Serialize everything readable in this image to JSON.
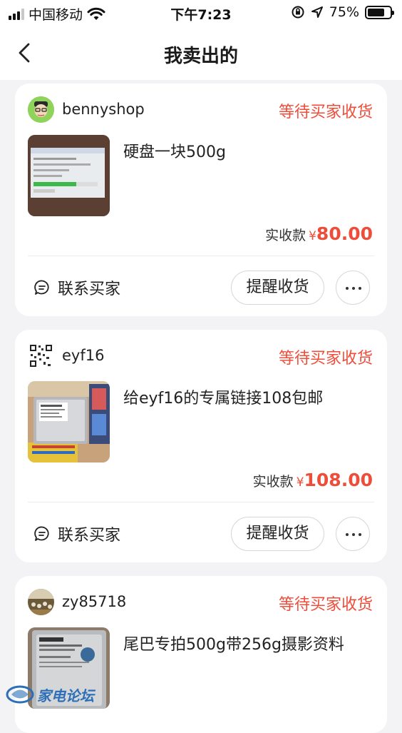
{
  "status_bar": {
    "carrier": "中国移动",
    "time": "下午7:23",
    "battery": "75%",
    "battery_level": 0.75
  },
  "nav": {
    "title": "我卖出的"
  },
  "orders": [
    {
      "username": "bennyshop",
      "status": "等待买家收货",
      "product_title": "硬盘一块500g",
      "price_label": "实收款",
      "currency": "¥",
      "amount": "80.00",
      "contact_label": "联系买家",
      "remind_label": "提醒收货"
    },
    {
      "username": "eyf16",
      "status": "等待买家收货",
      "product_title": "给eyf16的专属链接108包邮",
      "price_label": "实收款",
      "currency": "¥",
      "amount": "108.00",
      "contact_label": "联系买家",
      "remind_label": "提醒收货"
    },
    {
      "username": "zy85718",
      "status": "等待买家收货",
      "product_title": "尾巴专拍500g带256g摄影资料"
    }
  ],
  "watermark": {
    "text": "家电论坛"
  },
  "colors": {
    "accent": "#ee4d3a",
    "background": "#f3f3f5",
    "card": "#ffffff"
  }
}
